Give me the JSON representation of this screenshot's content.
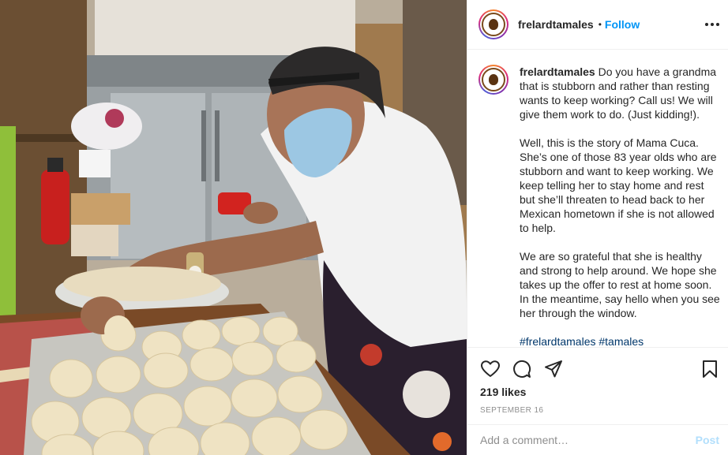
{
  "post": {
    "username": "frelardtamales",
    "separator": "•",
    "follow_label": "Follow"
  },
  "caption": {
    "author": "frelardtamales",
    "intro": "Do you have a grandma that is stubborn and rather than resting wants to keep working? Call us! We will give them work to do. (Just kidding!).",
    "paragraph2": "Well, this is the story of Mama Cuca. She’s one of those 83 year olds who are stubborn and want to keep working. We keep telling her to stay home and rest but she’ll threaten to head back to her Mexican hometown if she is not allowed to help.",
    "paragraph3": "We are so grateful that she is healthy and strong to help around. We hope she takes up the offer to rest at home soon. In the meantime, say hello when you see her through the window.",
    "hashtags": "#frelardtamales #tamales"
  },
  "actions": {
    "icons": [
      "heart-icon",
      "comment-icon",
      "share-icon",
      "bookmark-icon"
    ]
  },
  "likes_text": "219 likes",
  "date_text": "SEPTEMBER 16",
  "comment": {
    "placeholder": "Add a comment…",
    "post_label": "Post"
  },
  "colors": {
    "link_blue": "#0095f6",
    "post_disabled": "#b2dffc",
    "muted": "#8e8e8e",
    "brand_brown": "#7a4a1c"
  }
}
